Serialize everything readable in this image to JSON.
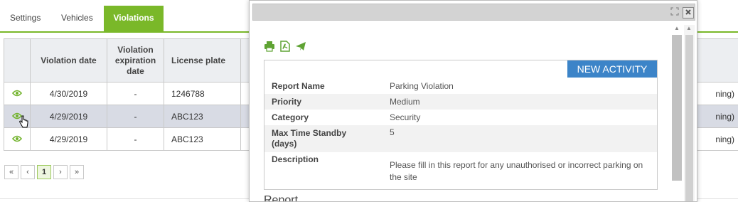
{
  "tabs": [
    {
      "label": "Settings"
    },
    {
      "label": "Vehicles"
    },
    {
      "label": "Violations"
    }
  ],
  "table": {
    "headers": {
      "violation_date": "Violation date",
      "expiration": "Violation expiration date",
      "license_plate": "License plate"
    },
    "rows": [
      {
        "date": "4/30/2019",
        "expiration": "-",
        "plate": "1246788",
        "tail": "ning)"
      },
      {
        "date": "4/29/2019",
        "expiration": "-",
        "plate": "ABC123",
        "tail": "ning)"
      },
      {
        "date": "4/29/2019",
        "expiration": "-",
        "plate": "ABC123",
        "tail": "ning)"
      }
    ]
  },
  "pager": {
    "first": "«",
    "prev": "‹",
    "current": "1",
    "next": "›",
    "last": "»"
  },
  "modal": {
    "new_activity_label": "NEW ACTIVITY",
    "fields": [
      {
        "label": "Report Name",
        "value": "Parking Violation"
      },
      {
        "label": "Priority",
        "value": "Medium"
      },
      {
        "label": "Category",
        "value": "Security"
      },
      {
        "label": "Max Time Standby (days)",
        "value": "5"
      },
      {
        "label": "Description",
        "value": "Please fill in this report for any unauthorised or incorrect parking on the site"
      }
    ],
    "section_heading": "Report"
  },
  "colors": {
    "accent_green": "#7ab829",
    "button_blue": "#3c84c8",
    "header_bg": "#eceef1",
    "selected_row": "#d8dbe4"
  },
  "icons": [
    "eye-icon",
    "print-icon",
    "pdf-icon",
    "send-icon",
    "expand-icon",
    "close-icon",
    "hand-cursor-icon"
  ]
}
